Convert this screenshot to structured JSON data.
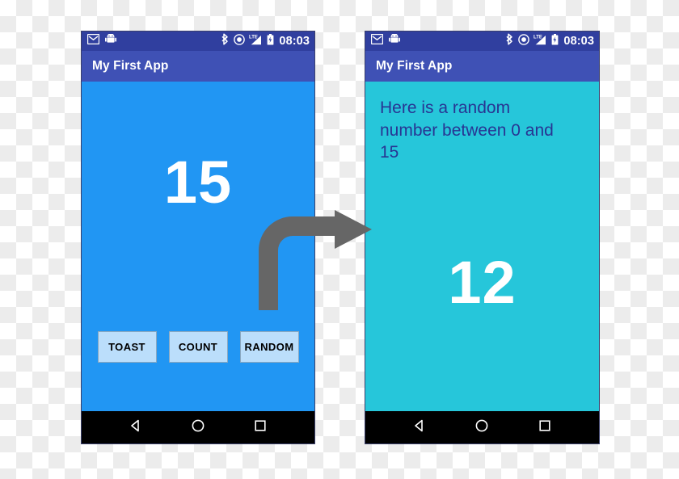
{
  "diagram": {
    "caption": "",
    "arrow": {
      "name": "curved-right-arrow",
      "color": "#666666",
      "direction": "up-then-right"
    },
    "background": "transparency-checkerboard"
  },
  "colors": {
    "status_bar": "#303f9f",
    "app_bar": "#3f51b5",
    "screen_one_background": "#2196f3",
    "screen_two_background": "#26c6da",
    "button_background": "#bbdefb",
    "hint_text": "#283593",
    "big_number": "#ffffff",
    "nav_bar": "#000000"
  },
  "status_bar": {
    "left_icons": [
      {
        "name": "email-icon",
        "label": "Email"
      },
      {
        "name": "android-robot-icon",
        "label": "Android"
      }
    ],
    "right_icons": [
      {
        "name": "bluetooth-icon",
        "label": "Bluetooth"
      },
      {
        "name": "location-icon",
        "label": "Location"
      },
      {
        "name": "lte-signal-icon",
        "label": "LTE"
      },
      {
        "name": "battery-icon",
        "label": "Battery"
      }
    ],
    "clock": "08:03"
  },
  "app_bar": {
    "title": "My First App"
  },
  "screens": [
    {
      "id": "screen-one",
      "app_title": "My First App",
      "clock": "08:03",
      "hint_text": "",
      "big_number": "15",
      "buttons": [
        {
          "name": "toast-button",
          "label": "TOAST"
        },
        {
          "name": "count-button",
          "label": "COUNT"
        },
        {
          "name": "random-button",
          "label": "RANDOM"
        }
      ]
    },
    {
      "id": "screen-two",
      "app_title": "My First App",
      "clock": "08:03",
      "hint_text": "Here is a random number between 0 and 15",
      "big_number": "12",
      "buttons": []
    }
  ],
  "nav_bar": {
    "buttons": [
      {
        "name": "back-button",
        "icon": "triangle-left-icon",
        "label": "Back"
      },
      {
        "name": "home-button",
        "icon": "circle-icon",
        "label": "Home"
      },
      {
        "name": "recents-button",
        "icon": "square-icon",
        "label": "Recents"
      }
    ]
  }
}
